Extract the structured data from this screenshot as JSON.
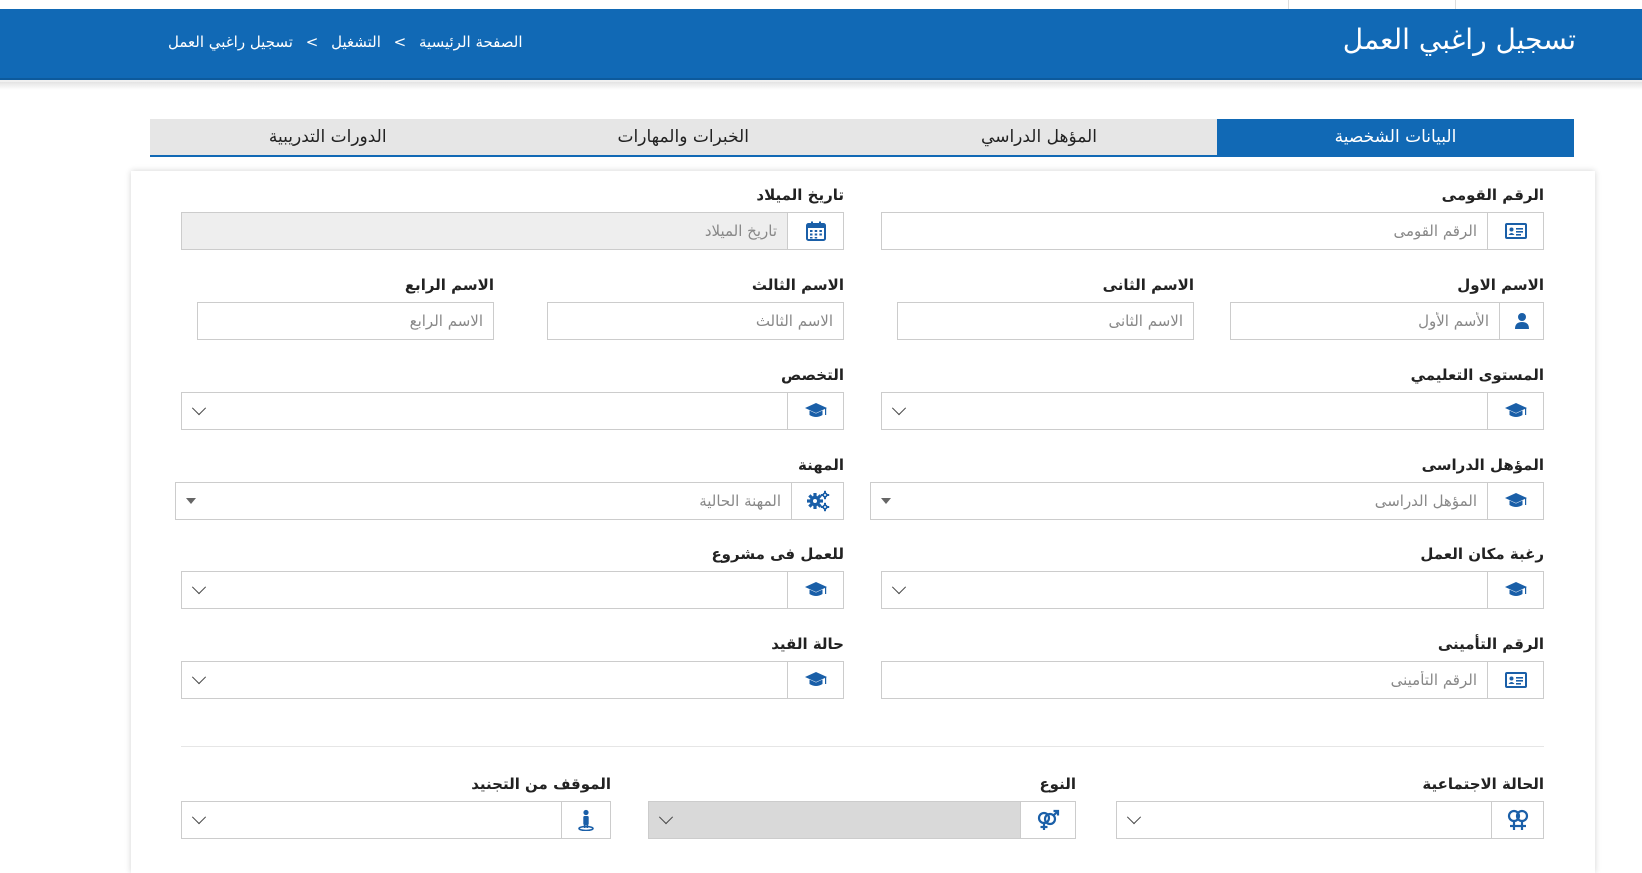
{
  "header": {
    "title": "تسجيل راغبي العمل",
    "breadcrumb": [
      "الصفحة الرئيسية",
      "التشغيل",
      "تسجيل راغبي العمل"
    ],
    "breadcrumb_sep": ">"
  },
  "tabs": [
    {
      "label": "البيانات الشخصية",
      "active": true
    },
    {
      "label": "المؤهل الدراسي",
      "active": false
    },
    {
      "label": "الخبرات والمهارات",
      "active": false
    },
    {
      "label": "الدورات التدريبية",
      "active": false
    }
  ],
  "form": {
    "national_id": {
      "label": "الرقم القومى",
      "placeholder": "الرقم القومى"
    },
    "birth_date": {
      "label": "تاريخ الميلاد",
      "placeholder": "تاريخ الميلاد"
    },
    "first_name": {
      "label": "الاسم الاول",
      "placeholder": "الأسم الأول"
    },
    "second_name": {
      "label": "الاسم الثانى",
      "placeholder": "الاسم الثانى"
    },
    "third_name": {
      "label": "الاسم الثالث",
      "placeholder": "الاسم الثالث"
    },
    "fourth_name": {
      "label": "الاسم الرابع",
      "placeholder": "الاسم الرابع"
    },
    "education_level": {
      "label": "المستوى التعليمي"
    },
    "specialization": {
      "label": "التخصص"
    },
    "qualification": {
      "label": "المؤهل الدراسى",
      "placeholder": "المؤهل الدراسى"
    },
    "profession": {
      "label": "المهنة",
      "placeholder": "المهنة الحالية"
    },
    "workplace_preference": {
      "label": "رغبة مكان العمل"
    },
    "project_work": {
      "label": "للعمل فى مشروع"
    },
    "insurance_number": {
      "label": "الرقم التأمينى",
      "placeholder": "الرقم التأمينى"
    },
    "registration_status": {
      "label": "حالة القيد"
    },
    "marital_status": {
      "label": "الحالة الاجتماعية"
    },
    "gender": {
      "label": "النوع"
    },
    "military_status": {
      "label": "الموقف من التجنيد"
    }
  },
  "colors": {
    "primary": "#1169b5",
    "tab_inactive": "#e6e6e6",
    "icon": "#1a5fa8"
  }
}
